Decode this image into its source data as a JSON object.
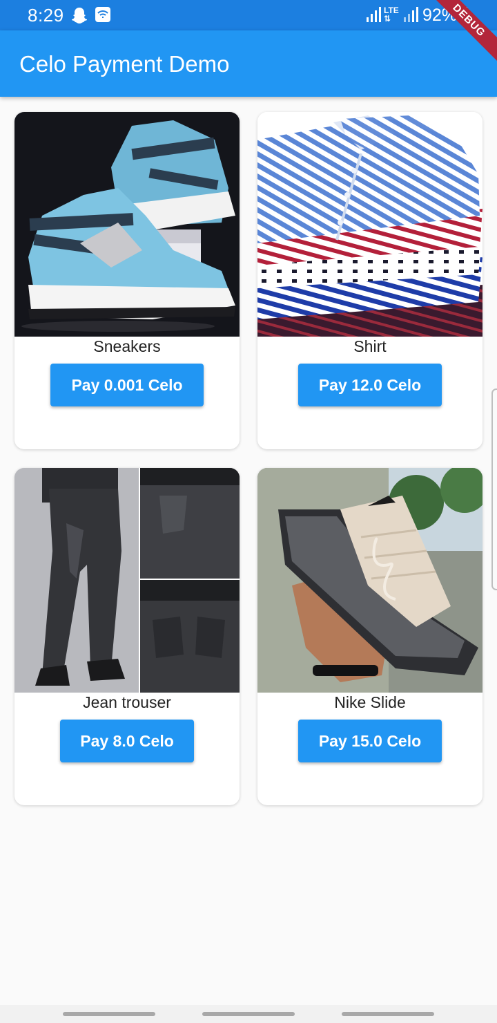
{
  "status_bar": {
    "time": "8:29",
    "network": "LTE",
    "battery": "92%",
    "debug_banner": "DEBUG"
  },
  "app_bar": {
    "title": "Celo Payment Demo",
    "color": "#2196f3"
  },
  "products": [
    {
      "name": "Sneakers",
      "button_label": "Pay 0.001 Celo",
      "image": "sneakers-photo"
    },
    {
      "name": "Shirt",
      "button_label": "Pay 12.0 Celo",
      "image": "striped-shirts-photo"
    },
    {
      "name": "Jean trouser",
      "button_label": "Pay 8.0 Celo",
      "image": "black-jeans-photo"
    },
    {
      "name": "Nike Slide",
      "button_label": "Pay 15.0 Celo",
      "image": "nike-slide-photo"
    }
  ],
  "colors": {
    "accent": "#2196f3",
    "status_bar": "#1c7fe0",
    "background": "#fafafa"
  }
}
